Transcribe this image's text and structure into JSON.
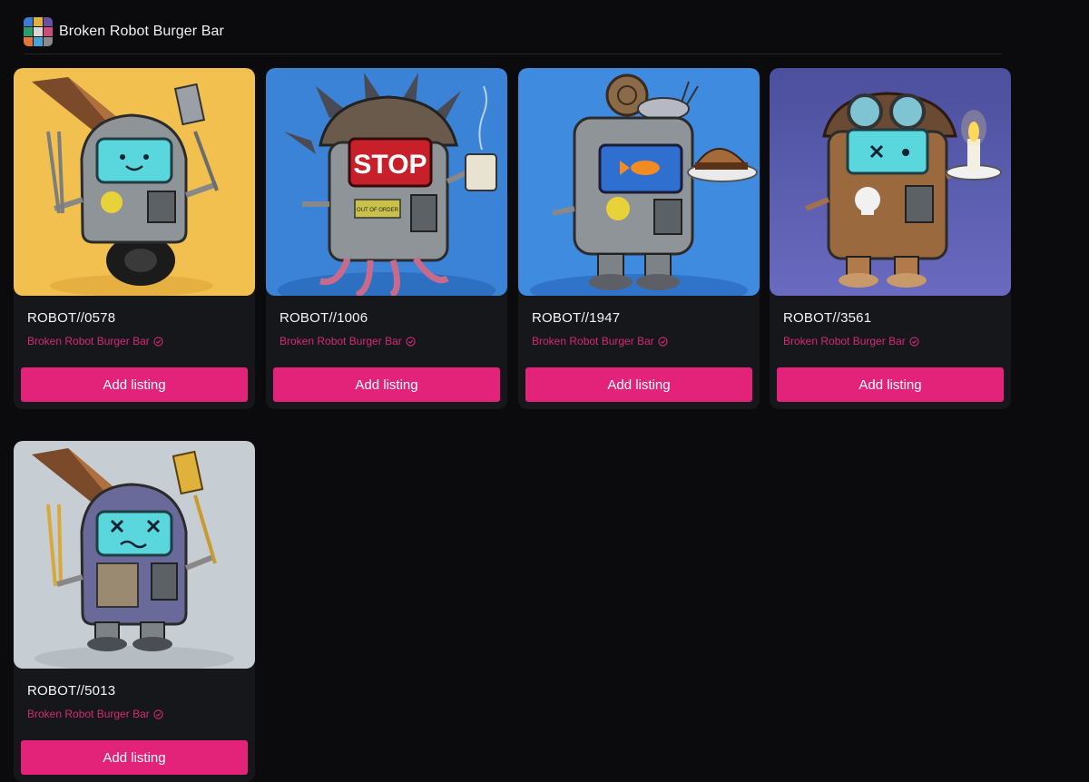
{
  "collection": {
    "name": "Broken Robot Burger Bar"
  },
  "nfts": [
    {
      "name": "ROBOT//0578",
      "collection": "Broken Robot Burger Bar",
      "action_label": "Add listing",
      "background": "#f2c04f"
    },
    {
      "name": "ROBOT//1006",
      "collection": "Broken Robot Burger Bar",
      "action_label": "Add listing",
      "background": "#3a83d6"
    },
    {
      "name": "ROBOT//1947",
      "collection": "Broken Robot Burger Bar",
      "action_label": "Add listing",
      "background": "#3f8be0"
    },
    {
      "name": "ROBOT//3561",
      "collection": "Broken Robot Burger Bar",
      "action_label": "Add listing",
      "background": "#5a5aa8"
    },
    {
      "name": "ROBOT//5013",
      "collection": "Broken Robot Burger Bar",
      "action_label": "Add listing",
      "background": "#c7ced3"
    }
  ],
  "image_text": {
    "stop_sign": "STOP",
    "plaque": "OUT OF ORDER"
  },
  "colors": {
    "accent": "#e3237a",
    "collection_text": "#d22a77",
    "card_bg": "#16171b",
    "page_bg": "#0b0b0e"
  }
}
